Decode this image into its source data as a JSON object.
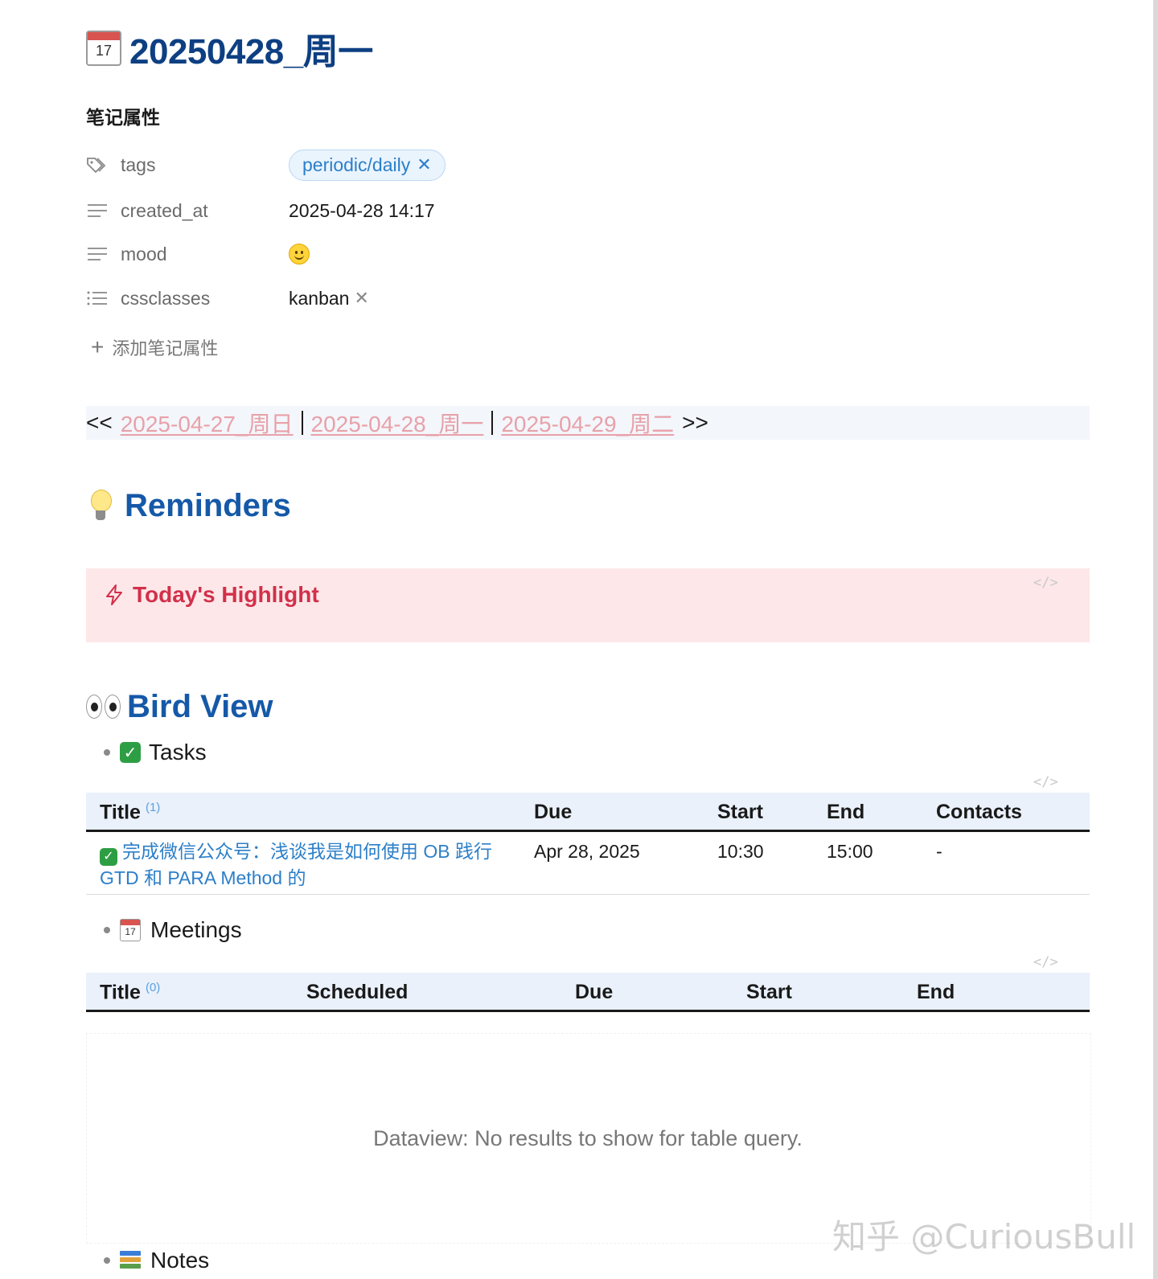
{
  "page": {
    "title": "20250428_周一",
    "title_icon": "calendar-icon",
    "title_icon_text": "17"
  },
  "properties": {
    "heading": "笔记属性",
    "items": [
      {
        "key": "tags",
        "icon": "tags-icon",
        "value": "periodic/daily"
      },
      {
        "key": "created_at",
        "icon": "text-lines-icon",
        "value": "2025-04-28 14:17"
      },
      {
        "key": "mood",
        "icon": "text-lines-icon",
        "value": "slightly-smiling-face"
      },
      {
        "key": "cssclasses",
        "icon": "list-icon",
        "value": "kanban"
      }
    ],
    "add_label": "添加笔记属性"
  },
  "nav": {
    "prev_arrow": "<<",
    "prev": "2025-04-27_周日",
    "current": "2025-04-28_周一",
    "next": "2025-04-29_周二",
    "next_arrow": ">>"
  },
  "reminders": {
    "heading": "Reminders",
    "callout_title": "Today's Highlight",
    "callout_color": "#d2304a"
  },
  "bird_view": {
    "heading": "Bird View",
    "code_marker": "</>",
    "tasks": {
      "label": "Tasks",
      "headers": [
        "Title",
        "Due",
        "Start",
        "End",
        "Contacts"
      ],
      "count": "(1)",
      "rows": [
        {
          "title_line1": "完成微信公众号：浅谈我是如何使用 OB 践行",
          "title_line2": "GTD 和 PARA Method 的",
          "due": "Apr 28, 2025",
          "start": "10:30",
          "end": "15:00",
          "contacts": "-"
        }
      ]
    },
    "meetings": {
      "label": "Meetings",
      "headers": [
        "Title",
        "Scheduled",
        "Due",
        "Start",
        "End"
      ],
      "count": "(0)",
      "empty_message": "Dataview: No results to show for table query."
    },
    "notes": {
      "label": "Notes"
    }
  },
  "watermark": "知乎 @CuriousBull",
  "colors": {
    "title": "#0d3f82",
    "heading": "#1559a8",
    "link": "#2c7fc9",
    "nav_link": "#e8a1a9",
    "table_header_bg": "#eaf1fb"
  }
}
